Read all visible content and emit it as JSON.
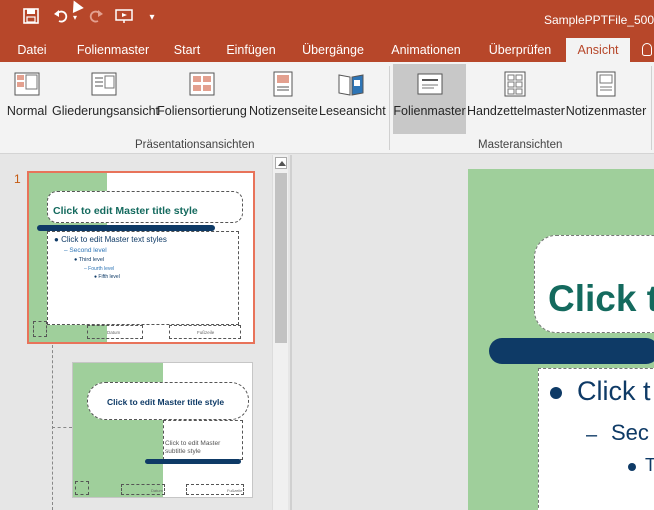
{
  "window": {
    "title": "SamplePPTFile_500"
  },
  "tabs": [
    "Datei",
    "Folienmaster",
    "Start",
    "Einfügen",
    "Übergänge",
    "Animationen",
    "Überprüfen",
    "Ansicht"
  ],
  "active_tab": "Ansicht",
  "ribbon": {
    "presentation_views": {
      "label": "Präsentationsansichten",
      "buttons": [
        "Normal",
        "Gliederungsansicht",
        "Foliensortierung",
        "Notizenseite",
        "Leseansicht"
      ]
    },
    "master_views": {
      "label": "Masteransichten",
      "buttons": [
        "Folienmaster",
        "Handzettelmaster",
        "Notizenmaster"
      ],
      "selected": "Folienmaster"
    }
  },
  "thumbnails": {
    "slide_number": "1",
    "master": {
      "title": "Click to edit Master title style",
      "text_levels": [
        "Click to edit Master text styles",
        "Second level",
        "Third level",
        "Fourth level",
        "Fifth level"
      ],
      "footer_date": "Datum",
      "footer_num": "Fußzeile"
    },
    "layout": {
      "title": "Click to edit Master title style",
      "subtitle": "Click to edit Master subtitle style",
      "footer_date": "Datum",
      "footer_num": "Fußzeile"
    }
  },
  "main_slide": {
    "title_partial": "Click t",
    "bullet1_partial": "Click t",
    "bullet2_partial": "Sec",
    "bullet3_partial": "T"
  },
  "colors": {
    "accent": "#b7472a",
    "slide_green": "#9fcf9b",
    "title_teal": "#146a5e",
    "navy": "#0e3a66"
  },
  "icons": {
    "save": "save-icon",
    "undo": "undo-icon",
    "redo": "redo-icon",
    "present": "present-from-start-icon",
    "customize": "customize-quick-access-icon",
    "tell_me": "lightbulb-icon"
  }
}
